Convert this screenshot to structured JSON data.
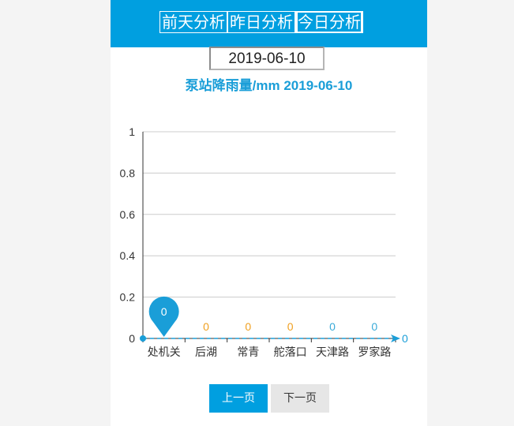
{
  "tabs": [
    {
      "label": "前天分析",
      "active": false
    },
    {
      "label": "昨日分析",
      "active": false
    },
    {
      "label": "今日分析",
      "active": true
    }
  ],
  "date_input": {
    "value": "2019-06-10"
  },
  "pager": {
    "prev_label": "上一页",
    "next_label": "下一页"
  },
  "colors": {
    "accent": "#009fe0",
    "orange": "#f0a020",
    "blue_label": "#3aaad8"
  },
  "chart_data": {
    "type": "bar",
    "title": "泵站降雨量/mm 2019-06-10",
    "categories": [
      "处机关",
      "后湖",
      "常青",
      "舵落口",
      "天津路",
      "罗家路"
    ],
    "values": [
      0,
      0,
      0,
      0,
      0,
      0
    ],
    "ylim": [
      0,
      1
    ],
    "yticks": [
      "0",
      "0.2",
      "0.4",
      "0.6",
      "0.8",
      "1"
    ],
    "grid": true,
    "markpoint": {
      "category": "处机关",
      "label": "0"
    },
    "markline_label": "0",
    "value_label_colors": [
      "#f0a020",
      "#f0a020",
      "#f0a020",
      "#f0a020",
      "#3aaad8",
      "#3aaad8"
    ]
  }
}
